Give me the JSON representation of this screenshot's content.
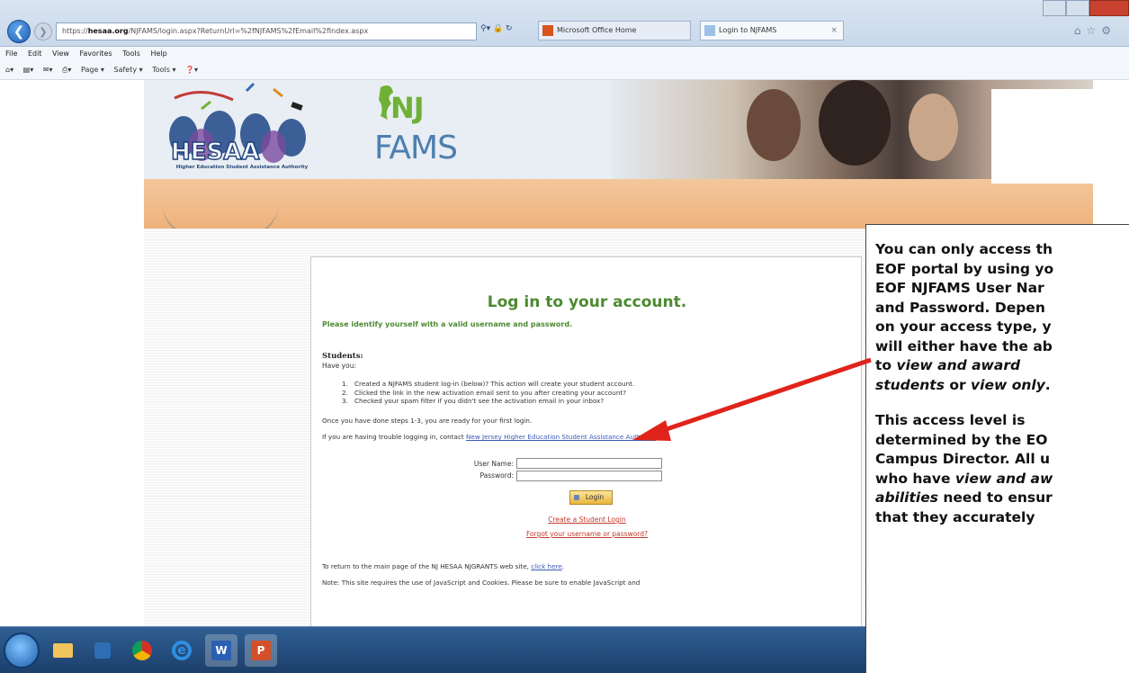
{
  "browser": {
    "url_scheme": "https://",
    "url_domain": "hesaa.org",
    "url_rest": "/NJFAMS/login.aspx?ReturnUrl=%2fNJFAMS%2fEmail%2fIndex.aspx",
    "tab_office_label": "Microsoft Office Home",
    "tab_njfams_label": "Login to NJFAMS",
    "tab_close": "×"
  },
  "menubar": [
    "File",
    "Edit",
    "View",
    "Favorites",
    "Tools",
    "Help"
  ],
  "commandbar": [
    "Page ▾",
    "Safety ▾",
    "Tools ▾"
  ],
  "site": {
    "hesaa_letters": "HESAA",
    "hesaa_tagline": "Higher Education Student Assistance Authority",
    "nj_text": "NJ",
    "fams_text": "FAMS"
  },
  "login": {
    "title": "Log in to your account.",
    "subtitle": "Please identify yourself with a valid username and password.",
    "students_label": "Students:",
    "have_you": "Have you:",
    "steps": [
      {
        "num": "1.",
        "text": "Created a NJFAMS student log-in (below)? This action will create your student account."
      },
      {
        "num": "2.",
        "text": "Clicked the link in the new activation email sent to you after creating your account?"
      },
      {
        "num": "3.",
        "text": "Checked your spam filter if you didn't see the activation email in your inbox?"
      }
    ],
    "once_text": "Once you have done steps 1-3, you are ready for your first login.",
    "trouble_text": "If you are having trouble logging in, contact ",
    "trouble_link": "New Jersey Higher Education Student Assistance Authority",
    "user_label": "User Name:",
    "pass_label": "Password:",
    "user_value": "",
    "pass_value": "",
    "login_button": "Login",
    "create_link": "Create a Student Login",
    "forgot_link": "Forgot your username or password?",
    "return_text": "To return to the main page of the NJ HESAA NJGRANTS web site, ",
    "click_here": "click here",
    "return_end": ".",
    "note_text": "Note: This site requires the use of JavaScript and Cookies. Please be sure to enable JavaScript and"
  },
  "callout": {
    "lines_p1": [
      "You can only access th",
      "EOF portal by using yo",
      "EOF NJFAMS User Nar",
      "and Password.  Depen",
      "on your access type, y",
      "will either have the ab"
    ],
    "p1_to": "to ",
    "p1_view_award": "view and award",
    "p1_students": "students",
    "p1_or": " or ",
    "p1_view_only": "view only",
    "p1_dot": ".",
    "lines_p2": [
      "This access level is",
      "determined by the EO",
      "Campus Director. All u"
    ],
    "p2_who": "who have ",
    "p2_view_aw": "view and aw",
    "p2_abilities": "abilities",
    "p2_ensure": " need to ensur",
    "p2_last": "that they accurately"
  },
  "colors": {
    "accent_green": "#4c8a31",
    "link_red": "#c1392b",
    "link_blue": "#3a5bb8",
    "arrow_red": "#e0241b",
    "header_band": "#f3c79c"
  },
  "icons": {
    "back": "back-arrow-icon",
    "forward": "forward-arrow-icon",
    "start": "windows-start-icon",
    "folder": "folder-icon",
    "media": "media-player-icon",
    "chrome": "chrome-icon",
    "ie": "internet-explorer-icon",
    "word": "word-icon",
    "powerpoint": "powerpoint-icon"
  }
}
